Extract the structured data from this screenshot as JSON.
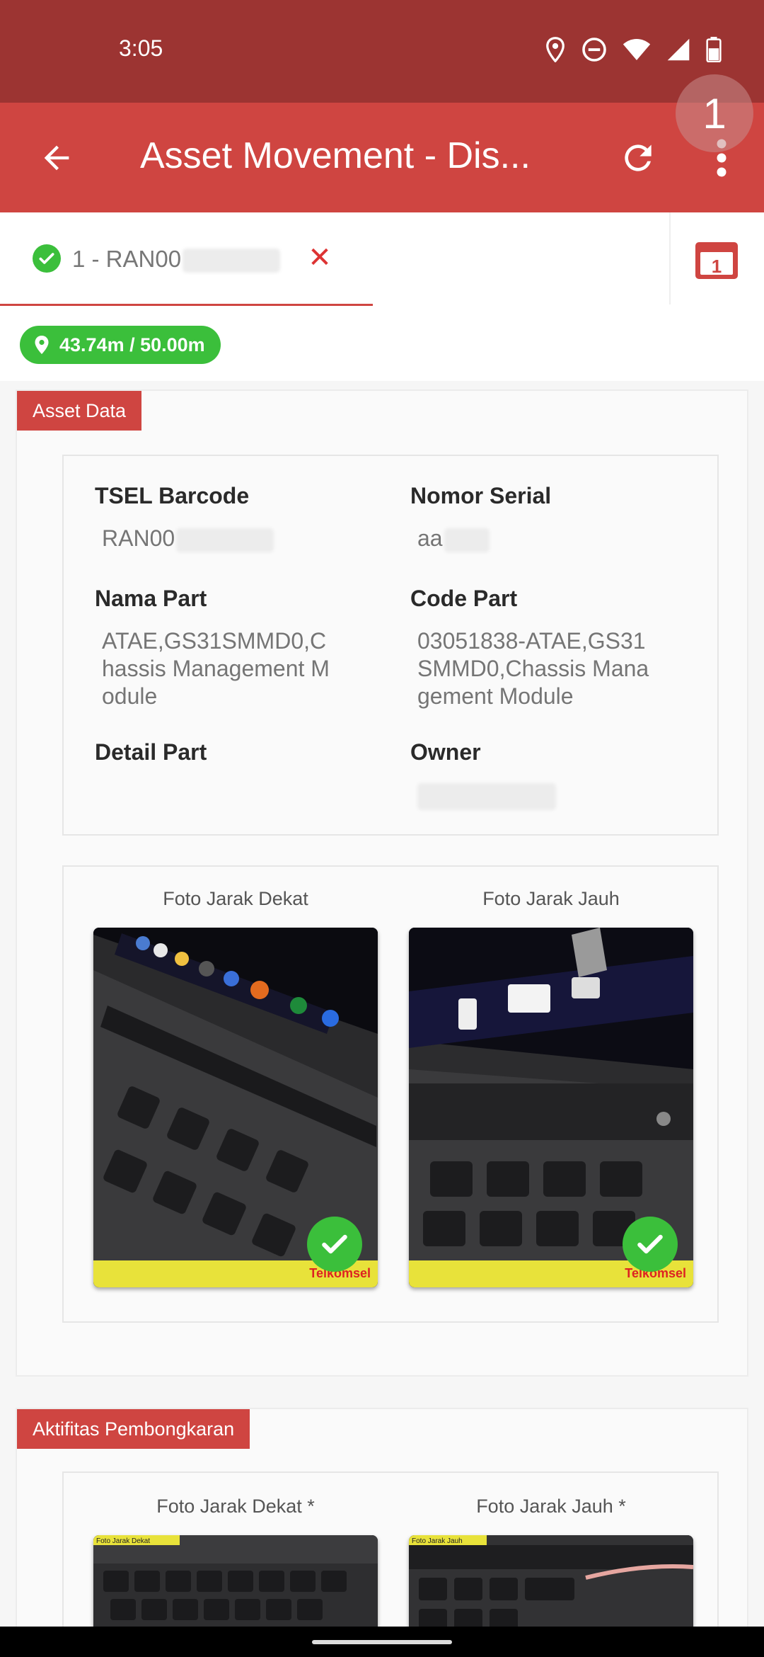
{
  "status_bar": {
    "time": "3:05",
    "icons": [
      "location-icon",
      "dnd-icon",
      "wifi-icon",
      "signal-icon",
      "battery-icon"
    ]
  },
  "app_bar": {
    "title": "Asset Movement - Dis...",
    "back_icon": "arrow-back-icon",
    "refresh_icon": "refresh-icon",
    "menu_icon": "more-vert-icon",
    "touch_indicator": "1"
  },
  "tabs": [
    {
      "label": "1 - RAN00",
      "status": "complete",
      "close_symbol": "✕"
    }
  ],
  "calendar_badge": "1",
  "distance": {
    "text": "43.74m / 50.00m",
    "icon": "location-pin-icon"
  },
  "asset_data": {
    "section_title": "Asset Data",
    "fields": {
      "tsel_barcode": {
        "label": "TSEL Barcode",
        "value": "RAN00"
      },
      "nomor_serial": {
        "label": "Nomor Serial",
        "value": "aa"
      },
      "nama_part": {
        "label": "Nama Part",
        "value": "ATAE,GS31SMMD0,Chassis Management Module"
      },
      "code_part": {
        "label": "Code Part",
        "value": "03051838-ATAE,GS31SMMD0,Chassis Management Module"
      },
      "detail_part": {
        "label": "Detail Part",
        "value": ""
      },
      "owner": {
        "label": "Owner",
        "value": ""
      }
    },
    "photos": [
      {
        "caption": "Foto Jarak Dekat",
        "status": "ok",
        "overlay_brand": "Telkomsel"
      },
      {
        "caption": "Foto Jarak Jauh",
        "status": "ok",
        "overlay_brand": "Telkomsel"
      }
    ]
  },
  "aktifitas": {
    "section_title": "Aktifitas Pembongkaran",
    "photos": [
      {
        "caption": "Foto Jarak Dekat *",
        "tag": "Foto Jarak Dekat"
      },
      {
        "caption": "Foto Jarak Jauh *",
        "tag": "Foto Jarak Jauh"
      }
    ]
  },
  "colors": {
    "status_bar": "#9c3432",
    "primary": "#cf4541",
    "success": "#3bbf3b"
  }
}
